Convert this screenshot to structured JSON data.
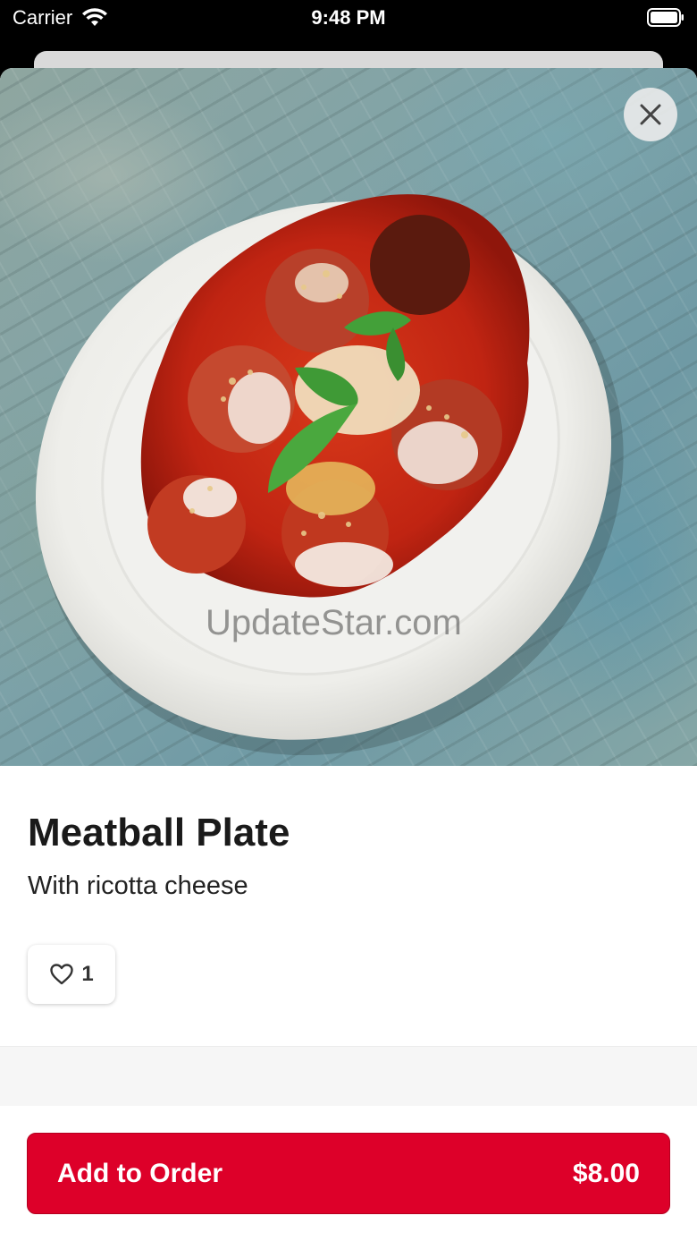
{
  "status_bar": {
    "carrier": "Carrier",
    "time": "9:48 PM"
  },
  "item": {
    "title": "Meatball Plate",
    "description": "With ricotta cheese",
    "image_watermark": "UpdateStar.com",
    "like_count": "1"
  },
  "order": {
    "add_label": "Add to Order",
    "price": "$8.00"
  },
  "colors": {
    "brand_red": "#dd0029",
    "sauce_red": "#c02412",
    "basil_green": "#3f9a36"
  },
  "icons": [
    "wifi-icon",
    "battery-icon",
    "close-icon",
    "heart-icon"
  ]
}
